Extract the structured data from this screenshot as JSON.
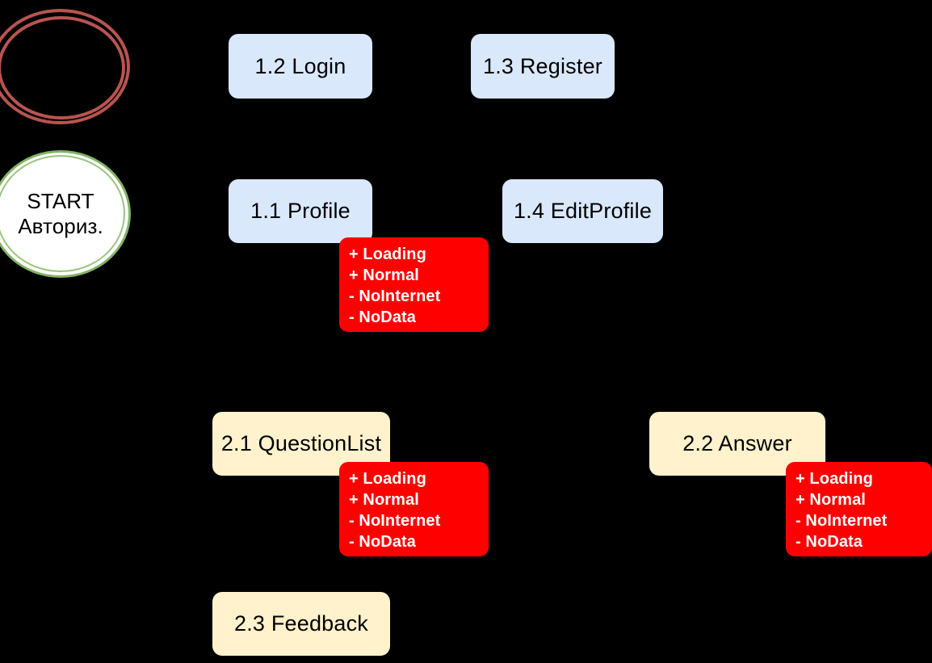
{
  "diagram": {
    "title": "App screen map",
    "background_color": "#000000",
    "palette": {
      "blue_node": "#dae8fc",
      "cream_node": "#fff2cc",
      "state_box": "#ff0000",
      "state_text": "#ffffff",
      "red_circle_stroke": "#b85450",
      "green_circle_stroke": "#82b366",
      "circle_fill": "#ffffff",
      "node_text": "#000000"
    }
  },
  "start_node": {
    "name": "start-authorization",
    "line1": "START",
    "line2": "Авториз."
  },
  "nodes": [
    {
      "id": "1.2",
      "label": "1.2 Login",
      "style": "blue"
    },
    {
      "id": "1.3",
      "label": "1.3 Register",
      "style": "blue"
    },
    {
      "id": "1.1",
      "label": "1.1 Profile",
      "style": "blue"
    },
    {
      "id": "1.4",
      "label": "1.4 EditProfile",
      "style": "blue"
    },
    {
      "id": "2.1",
      "label": "2.1 QuestionList",
      "style": "cream"
    },
    {
      "id": "2.2",
      "label": "2.2 Answer",
      "style": "cream"
    },
    {
      "id": "2.3",
      "label": "2.3 Feedback",
      "style": "cream"
    }
  ],
  "state_boxes": [
    {
      "owner": "1.1 Profile",
      "lines": [
        "+ Loading",
        "+ Normal",
        "- NoInternet",
        "- NoData"
      ]
    },
    {
      "owner": "2.1 QuestionList",
      "lines": [
        "+ Loading",
        "+ Normal",
        "- NoInternet",
        "- NoData"
      ]
    },
    {
      "owner": "2.2 Answer",
      "lines": [
        "+ Loading",
        "+ Normal",
        "- NoInternet",
        "- NoData"
      ]
    }
  ]
}
